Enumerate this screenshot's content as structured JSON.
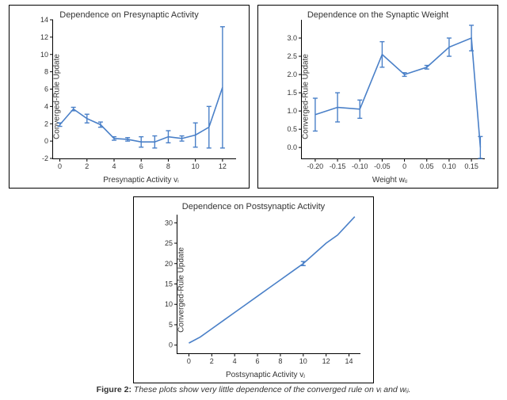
{
  "caption_prefix": "Figure 2:",
  "caption_rest": " These plots show very little dependence of the converged rule on vᵢ and wᵢⱼ.",
  "chart_data": [
    {
      "id": "pa",
      "type": "line",
      "title": "Dependence on Presynaptic Activity",
      "xlabel": "Presynaptic Activity vᵢ",
      "ylabel": "Converged-Rule Update",
      "xlim": [
        -0.5,
        13
      ],
      "ylim": [
        -2,
        14
      ],
      "xticks": [
        0,
        2,
        4,
        6,
        8,
        10,
        12
      ],
      "yticks": [
        -2,
        0,
        2,
        4,
        6,
        8,
        10,
        12,
        14
      ],
      "x": [
        0,
        1,
        2,
        3,
        4,
        5,
        6,
        7,
        8,
        9,
        10,
        11,
        12
      ],
      "values": [
        1.9,
        3.7,
        2.6,
        1.9,
        0.3,
        0.2,
        -0.1,
        -0.1,
        0.5,
        0.3,
        0.7,
        1.6,
        6.2
      ],
      "err": [
        0.2,
        0.2,
        0.5,
        0.3,
        0.2,
        0.2,
        0.6,
        0.7,
        0.7,
        0.3,
        1.4,
        2.4,
        7.0
      ]
    },
    {
      "id": "pb",
      "type": "line",
      "title": "Dependence on the Synaptic Weight",
      "xlabel": "Weight wᵢⱼ",
      "ylabel": "Converged-Rule Update",
      "xlim": [
        -0.23,
        0.18
      ],
      "ylim": [
        -0.3,
        3.5
      ],
      "xticks": [
        -0.2,
        -0.15,
        -0.1,
        -0.05,
        0.0,
        0.05,
        0.1,
        0.15
      ],
      "yticks": [
        0.0,
        0.5,
        1.0,
        1.5,
        2.0,
        2.5,
        3.0
      ],
      "x": [
        -0.2,
        -0.15,
        -0.1,
        -0.05,
        0.0,
        0.05,
        0.1,
        0.15,
        0.17
      ],
      "values": [
        0.9,
        1.1,
        1.05,
        2.55,
        2.0,
        2.2,
        2.75,
        3.0,
        0.0
      ],
      "err": [
        0.45,
        0.4,
        0.25,
        0.35,
        0.05,
        0.05,
        0.25,
        0.35,
        0.3
      ]
    },
    {
      "id": "pc",
      "type": "line",
      "title": "Dependence on Postsynaptic Activity",
      "xlabel": "Postsynaptic Activity vⱼ",
      "ylabel": "Converged-Rule Update",
      "xlim": [
        -1,
        15
      ],
      "ylim": [
        -2,
        32
      ],
      "xticks": [
        0,
        2,
        4,
        6,
        8,
        10,
        12,
        14
      ],
      "yticks": [
        0,
        5,
        10,
        15,
        20,
        25,
        30
      ],
      "x": [
        0,
        1,
        2,
        3,
        4,
        5,
        6,
        7,
        8,
        9,
        10,
        11,
        12,
        13,
        14,
        14.5
      ],
      "values": [
        0.5,
        2.0,
        4.0,
        6.0,
        8.0,
        10.0,
        12.0,
        14.0,
        16.0,
        18.0,
        20.0,
        22.5,
        25.0,
        27.0,
        30.0,
        31.5
      ],
      "err": [
        0,
        0,
        0,
        0,
        0,
        0,
        0,
        0,
        0,
        0,
        0.5,
        0,
        0,
        0,
        0,
        0
      ]
    }
  ]
}
